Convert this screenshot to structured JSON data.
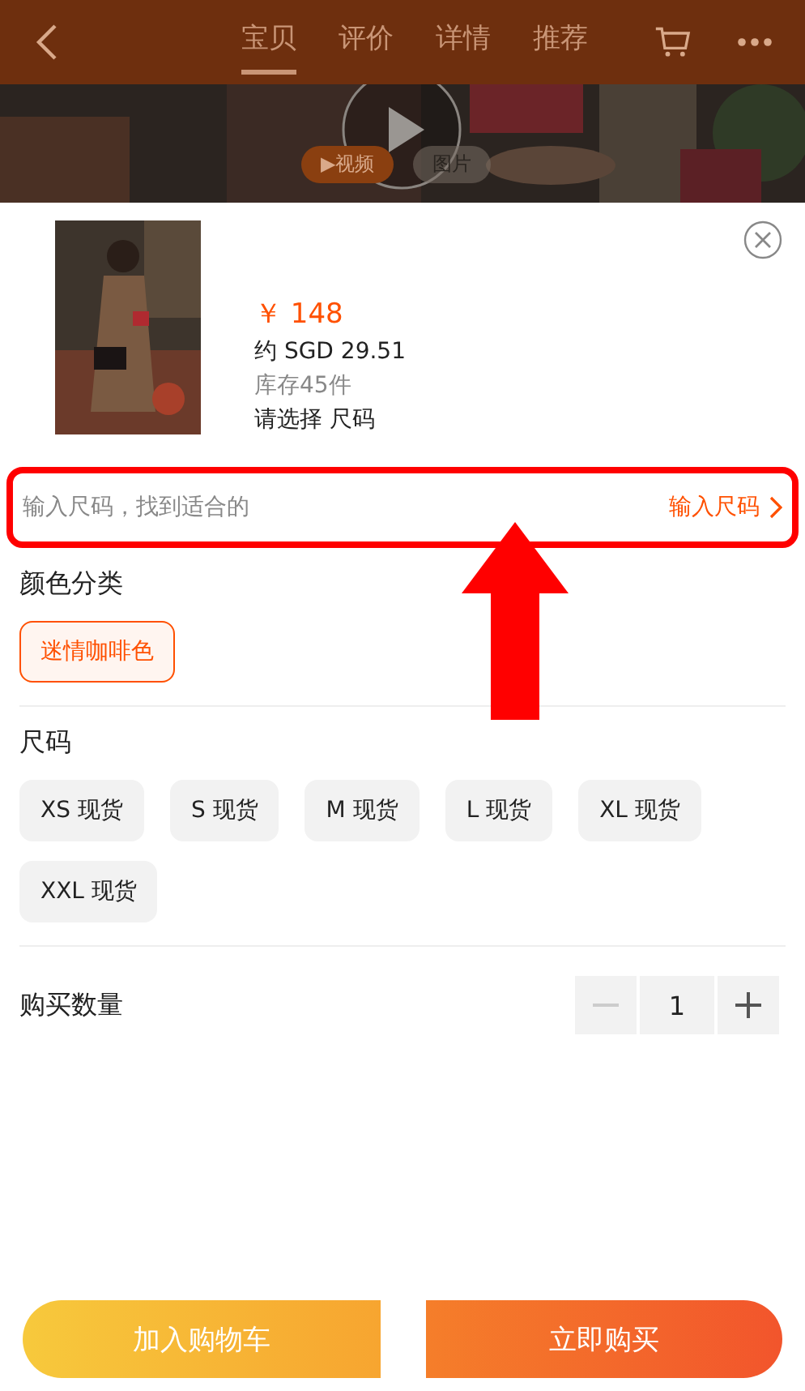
{
  "top_bar": {
    "tabs": [
      {
        "label": "宝贝",
        "selected": true
      },
      {
        "label": "评价",
        "selected": false
      },
      {
        "label": "详情",
        "selected": false
      },
      {
        "label": "推荐",
        "selected": false
      }
    ]
  },
  "media": {
    "kind": "picture",
    "switch": [
      {
        "label": "▶视频",
        "selected": true
      },
      {
        "label": "图片",
        "selected": false
      }
    ]
  },
  "product": {
    "price": "￥ 148",
    "converted_price": "约 SGD 29.51",
    "stock": "库存45件",
    "selection_prompt": "请选择 尺码"
  },
  "size_finder": {
    "hint": "输入尺码，找到适合的",
    "link": "输入尺码"
  },
  "options": [
    {
      "title": "颜色分类",
      "values": [
        {
          "label": "迷情咖啡色",
          "selected": true
        }
      ]
    },
    {
      "title": "尺码",
      "values": [
        {
          "label": "XS 现货",
          "selected": false
        },
        {
          "label": "S 现货",
          "selected": false
        },
        {
          "label": "M 现货",
          "selected": false
        },
        {
          "label": "L 现货",
          "selected": false
        },
        {
          "label": "XL 现货",
          "selected": false
        },
        {
          "label": "XXL 现货",
          "selected": false
        }
      ]
    }
  ],
  "quantity": {
    "label": "购买数量",
    "value": "1",
    "decrease_disabled": true
  },
  "actions": [
    {
      "label": "加入购物车",
      "kind": "cart"
    },
    {
      "label": "立即购买",
      "kind": "buy"
    }
  ]
}
